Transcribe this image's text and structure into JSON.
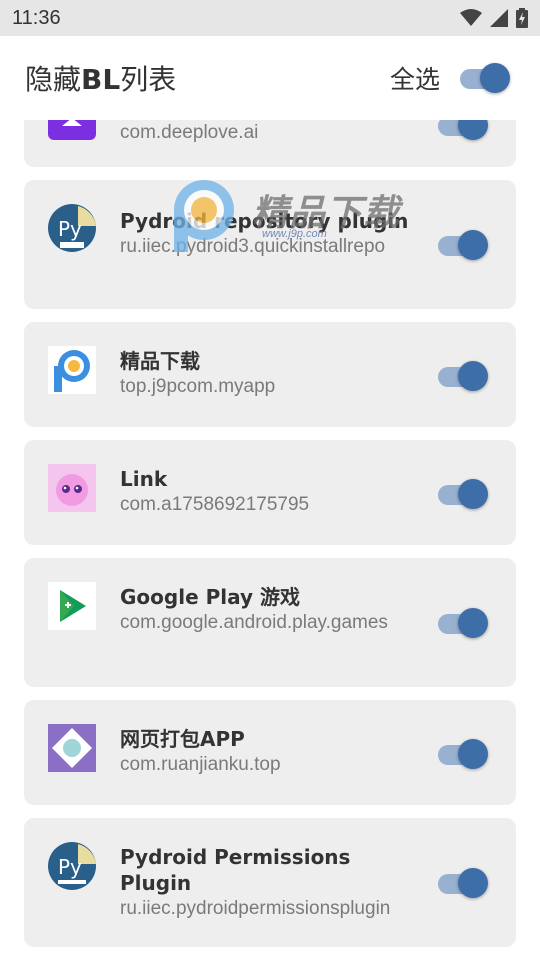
{
  "status_bar": {
    "time": "11:36"
  },
  "app_bar": {
    "title_prefix": "隐藏",
    "title_bold": "BL",
    "title_suffix": "列表",
    "select_all_label": "全选",
    "select_all_on": true
  },
  "colors": {
    "accent": "#3d6ea8",
    "track": "#98b1d0",
    "card_bg": "#eeeeee",
    "status_bar_bg": "#e6e6e6"
  },
  "apps": [
    {
      "name": "",
      "package": "com.deeplove.ai",
      "icon": "deeplove-purple-icon",
      "enabled": true
    },
    {
      "name": "Pydroid repository plugin",
      "package": "ru.iiec.pydroid3.quickinstallrepo",
      "icon": "pydroid-repo-icon",
      "enabled": true
    },
    {
      "name": "精品下载",
      "package": "top.j9pcom.myapp",
      "icon": "j9p-download-icon",
      "enabled": true
    },
    {
      "name": "Link",
      "package": "com.a1758692175795",
      "icon": "pink-creature-icon",
      "enabled": true
    },
    {
      "name": "Google Play 游戏",
      "package": "com.google.android.play.games",
      "icon": "google-play-games-icon",
      "enabled": true
    },
    {
      "name": "网页打包APP",
      "package": "com.ruanjianku.top",
      "icon": "webpack-app-icon",
      "enabled": true
    },
    {
      "name": "Pydroid Permissions Plugin",
      "package": "ru.iiec.pydroidpermissionsplugin",
      "icon": "pydroid-permissions-icon",
      "enabled": true
    }
  ],
  "watermark": {
    "text": "精品下载",
    "url": "www.j9p.com"
  }
}
